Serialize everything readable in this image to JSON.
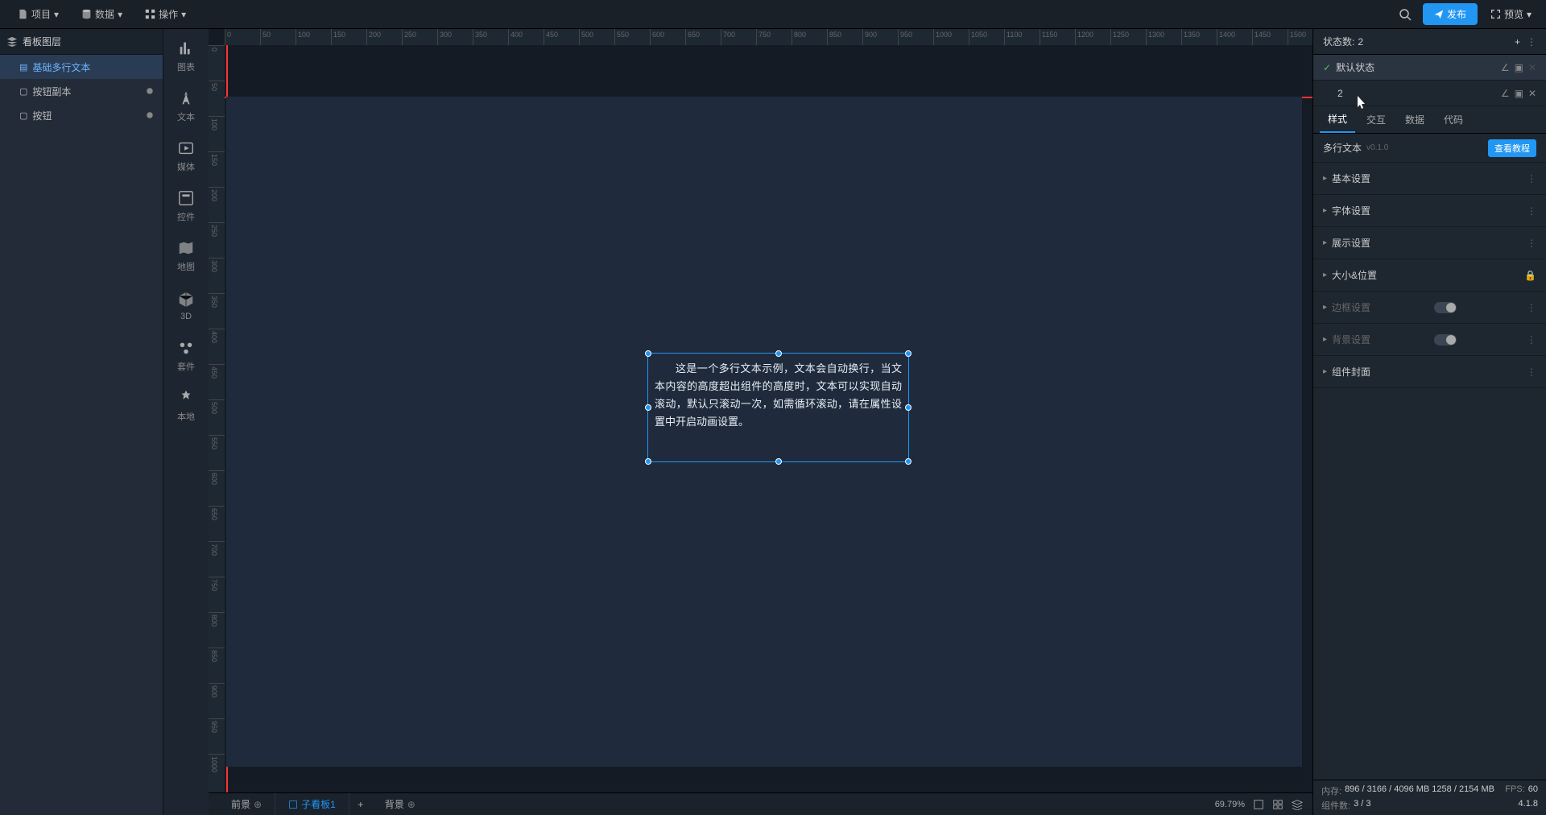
{
  "topbar": {
    "project": "项目",
    "data": "数据",
    "operate": "操作",
    "publish": "发布",
    "preview": "预览"
  },
  "left": {
    "title": "看板图层",
    "layers": [
      {
        "name": "基础多行文本",
        "active": true,
        "indicator": false
      },
      {
        "name": "按钮副本",
        "active": false,
        "indicator": true
      },
      {
        "name": "按钮",
        "active": false,
        "indicator": true
      }
    ]
  },
  "compbar": [
    {
      "key": "chart",
      "label": "图表"
    },
    {
      "key": "text",
      "label": "文本"
    },
    {
      "key": "media",
      "label": "媒体"
    },
    {
      "key": "ctrl",
      "label": "控件"
    },
    {
      "key": "map",
      "label": "地图"
    },
    {
      "key": "3d",
      "label": "3D"
    },
    {
      "key": "suite",
      "label": "套件"
    },
    {
      "key": "local",
      "label": "本地"
    }
  ],
  "canvas": {
    "text": "这是一个多行文本示例，文本会自动换行，当文本内容的高度超出组件的高度时，文本可以实现自动滚动，默认只滚动一次，如需循环滚动，请在属性设置中开启动画设置。",
    "ruler_h": [
      0,
      50,
      100,
      150,
      200,
      250,
      300,
      350,
      400,
      450,
      500,
      550,
      600,
      650,
      700,
      750,
      800,
      850,
      900,
      950,
      1000,
      1050,
      1100,
      1150,
      1200,
      1250,
      1300,
      1350,
      1400,
      1450,
      1500
    ],
    "ruler_v": [
      0,
      50,
      100,
      150,
      200,
      250,
      300,
      350,
      400,
      450,
      500,
      550,
      600,
      650,
      700,
      750,
      800,
      850,
      900,
      950,
      1000
    ]
  },
  "bottom": {
    "foreground": "前景",
    "subpanel": "子看板1",
    "background": "背景"
  },
  "right": {
    "state_count_label": "状态数:",
    "state_count": "2",
    "states": [
      {
        "name": "默认状态",
        "active": true,
        "closable": false
      },
      {
        "name": "2",
        "active": false,
        "closable": true
      }
    ],
    "tabs": [
      "样式",
      "交互",
      "数据",
      "代码"
    ],
    "active_tab": 0,
    "component_name": "多行文本",
    "version": "v0.1.0",
    "tutorial": "查看教程",
    "sections": [
      {
        "label": "基本设置",
        "type": "normal"
      },
      {
        "label": "字体设置",
        "type": "normal"
      },
      {
        "label": "展示设置",
        "type": "normal"
      },
      {
        "label": "大小&位置",
        "type": "lock"
      },
      {
        "label": "边框设置",
        "type": "toggle"
      },
      {
        "label": "背景设置",
        "type": "toggle"
      },
      {
        "label": "组件封面",
        "type": "normal"
      }
    ]
  },
  "zoom": {
    "value": "69.79%"
  },
  "status": {
    "mem_label": "内存:",
    "mem_value": "896 / 3166 / 4096 MB 1258 / 2154 MB",
    "fps_label": "FPS:",
    "fps_value": "60",
    "comp_label": "组件数:",
    "comp_value": "3 / 3",
    "version": "4.1.8"
  }
}
